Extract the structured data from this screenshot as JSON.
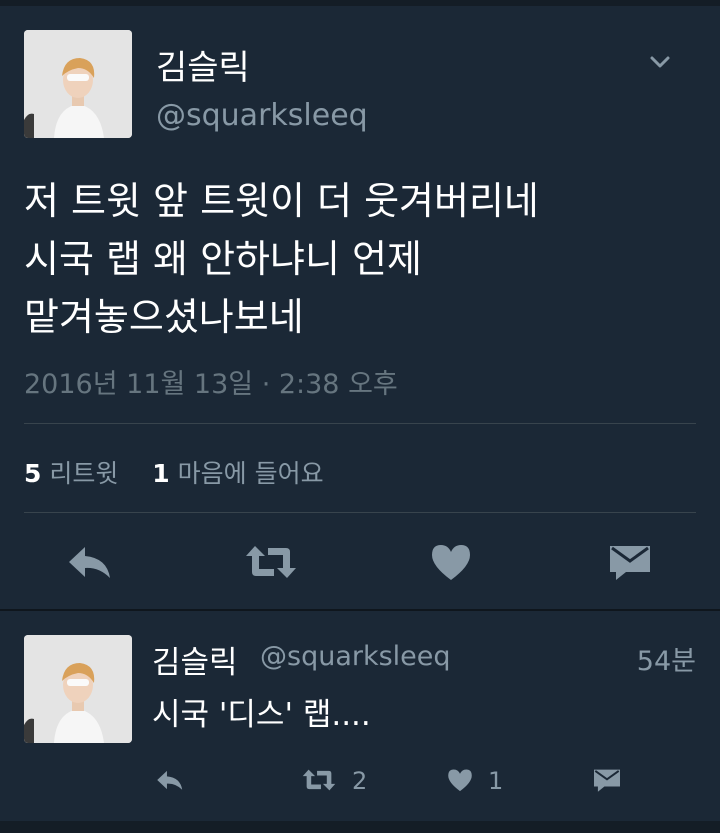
{
  "main_tweet": {
    "author_name": "김슬릭",
    "author_handle": "@squarksleeq",
    "text_lines": [
      "저 트윗 앞 트윗이 더 웃겨버리네",
      "시국 랩 왜 안하냐니 언제",
      "맡겨놓으셨나보네"
    ],
    "timestamp": "2016년 11월 13일 · 2:38 오후",
    "retweet_count": "5",
    "retweet_label": "리트윗",
    "like_count": "1",
    "like_label": "마음에 들어요",
    "icons": [
      "chevron-down-icon",
      "reply-icon",
      "retweet-icon",
      "heart-icon",
      "direct-message-icon"
    ]
  },
  "reply_tweet": {
    "author_name": "김슬릭",
    "author_handle": "@squarksleeq",
    "time_ago": "54분",
    "text": "시국 '디스' 랩....",
    "retweet_count": "2",
    "like_count": "1",
    "icons": [
      "reply-icon",
      "retweet-icon",
      "heart-icon",
      "direct-message-icon"
    ]
  },
  "colors": {
    "background": "#1b2836",
    "text_primary": "#ffffff",
    "text_secondary": "#8899a6",
    "icon": "#8899a6",
    "divider": "#38444d"
  }
}
